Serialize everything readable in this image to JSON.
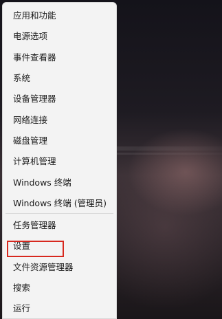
{
  "menu": {
    "items": [
      {
        "label": "应用和功能"
      },
      {
        "label": "电源选项"
      },
      {
        "label": "事件查看器"
      },
      {
        "label": "系统"
      },
      {
        "label": "设备管理器"
      },
      {
        "label": "网络连接"
      },
      {
        "label": "磁盘管理"
      },
      {
        "label": "计算机管理"
      },
      {
        "label": "Windows 终端"
      },
      {
        "label": "Windows 终端 (管理员)"
      },
      {
        "label": "任务管理器"
      },
      {
        "label": "设置"
      },
      {
        "label": "文件资源管理器"
      },
      {
        "label": "搜索"
      },
      {
        "label": "运行"
      }
    ]
  },
  "colors": {
    "menu_background": "#f3f3f3",
    "highlight_border": "#d7281e"
  }
}
